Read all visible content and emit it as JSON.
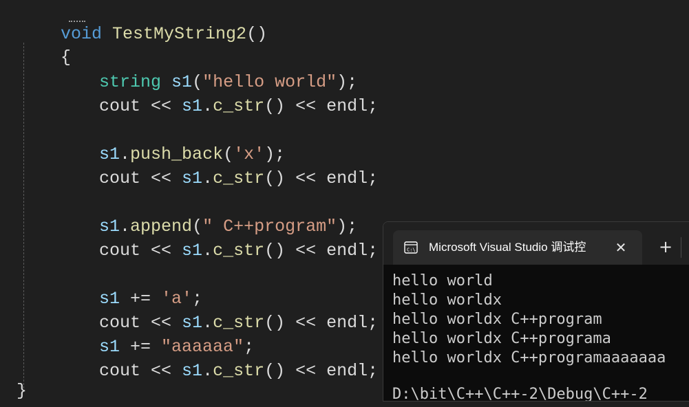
{
  "editor": {
    "lines": {
      "l1": [
        "void ",
        "TestMyString2",
        "()"
      ],
      "l2": [
        "{"
      ],
      "l3": [
        "string ",
        "s1",
        "(",
        "\"hello world\"",
        ");"
      ],
      "l4": [
        "cout << ",
        "s1",
        ".",
        "c_str",
        "() << endl;"
      ],
      "l6": [
        "s1",
        ".",
        "push_back",
        "(",
        "'x'",
        ");"
      ],
      "l7": [
        "cout << ",
        "s1",
        ".",
        "c_str",
        "() << endl;"
      ],
      "l9": [
        "s1",
        ".",
        "append",
        "(",
        "\" C++program\"",
        ");"
      ],
      "l10": [
        "cout << ",
        "s1",
        ".",
        "c_str",
        "() << endl;"
      ],
      "l12": [
        "s1",
        " += ",
        "'a'",
        ";"
      ],
      "l13": [
        "cout << ",
        "s1",
        ".",
        "c_str",
        "() << endl;"
      ],
      "l14": [
        "s1",
        " += ",
        "\"aaaaaa\"",
        ";"
      ],
      "l15": [
        "cout << ",
        "s1",
        ".",
        "c_str",
        "() << endl;"
      ],
      "l17": [
        "}"
      ]
    }
  },
  "console": {
    "tab_title": "Microsoft Visual Studio 调试控",
    "close_glyph": "✕",
    "new_tab_glyph": "+",
    "output": [
      "hello world",
      "hello worldx",
      "hello worldx C++program",
      "hello worldx C++programa",
      "hello worldx C++programaaaaaaa",
      "",
      "D:\\bit\\C++\\C++-2\\Debug\\C++-2"
    ]
  },
  "colors": {
    "keyword": "#569cd6",
    "function": "#dcdcaa",
    "type": "#4ec9b0",
    "variable": "#9cdcfe",
    "string": "#d69d85",
    "editor_bg": "#1f1f1f",
    "console_bg": "#0c0c0c"
  },
  "icons": {
    "console_tab": "terminal-icon"
  }
}
